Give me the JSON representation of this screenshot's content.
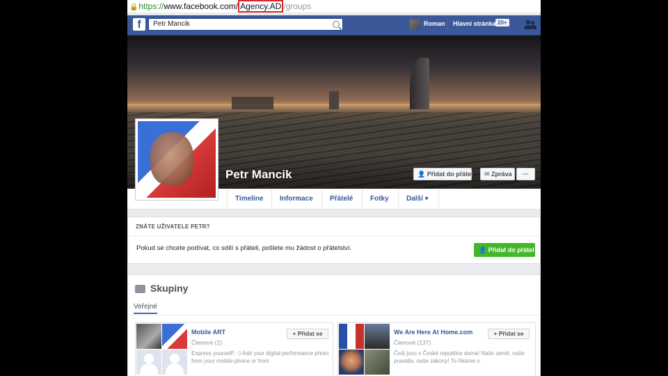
{
  "browser": {
    "url_scheme": "https://",
    "url_host": "www.facebook.com/",
    "url_highlight": "Agency.AD",
    "url_rest": "/groups"
  },
  "topbar": {
    "logo": "f",
    "search_value": "Petr Mancik",
    "user_name": "Roman",
    "home_label": "Hlavní stránka",
    "home_badge": "20+"
  },
  "profile": {
    "name": "Petr Mancik",
    "add_friend_label": "Přidat do přátel",
    "message_label": "Zpráva",
    "more_label": "···"
  },
  "tabs": [
    {
      "label": "Timeline"
    },
    {
      "label": "Informace"
    },
    {
      "label": "Přátelé"
    },
    {
      "label": "Fotky"
    },
    {
      "label": "Další ▾"
    }
  ],
  "know_panel": {
    "heading": "ZNÁTE UŽIVATELE PETR?",
    "text": "Pokud se chcete podívat, co sdílí s přáteli, pošlete mu žádost o přátelství.",
    "button_label": "Přidat do přátel"
  },
  "groups": {
    "title": "Skupiny",
    "tab": "Veřejné",
    "items": [
      {
        "name": "Mobile ART",
        "members": "Členové (2)",
        "description": "Express yourself! :-) Add your digital performance photo from your mobile phone or from",
        "button_label": "+ Přidat se"
      },
      {
        "name": "We Are Here At Home.com",
        "members": "Členové (137)",
        "description": "Češi jsou v České republice doma! Naše země, naše pravidla, naše zákony! To říkáme o",
        "button_label": "+ Přidat se"
      }
    ]
  },
  "colors": {
    "facebook_blue": "#3b5998",
    "link_blue": "#365899",
    "green": "#42b72a",
    "highlight_red": "#d62828"
  }
}
